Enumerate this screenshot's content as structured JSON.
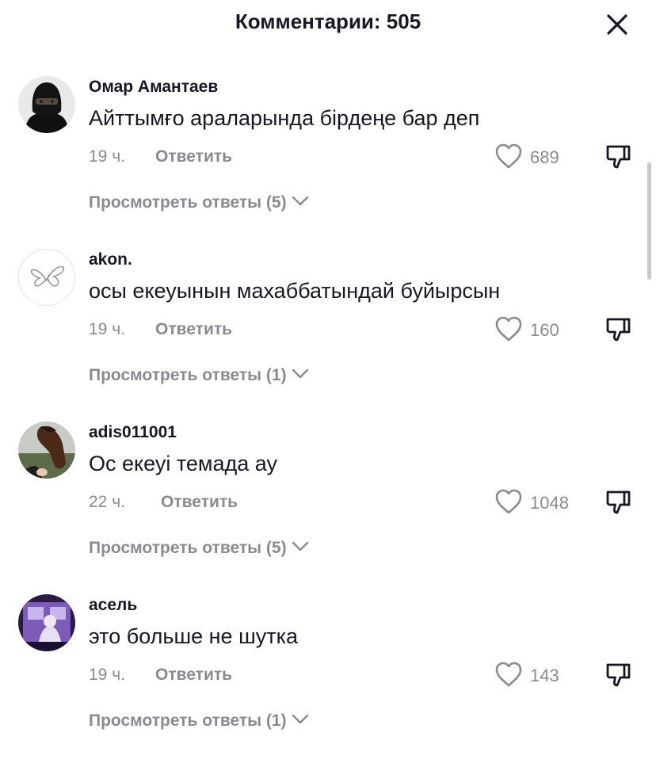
{
  "header": {
    "title": "Комментарии: 505",
    "close_icon": "close-icon"
  },
  "colors": {
    "text": "#161823",
    "secondary": "#8a8b91",
    "background": "#ffffff"
  },
  "comments": [
    {
      "username": "Омар Амантаев",
      "text": "Айттымғо араларында бірдеңе бар деп",
      "time": "19 ч.",
      "reply_label": "Ответить",
      "likes": "689",
      "view_replies": "Просмотреть ответы (5)",
      "avatar": "masked-person-avatar"
    },
    {
      "username": "akon.",
      "text": "осы екеуынын махаббатындай буйырсын",
      "time": "19 ч.",
      "reply_label": "Ответить",
      "likes": "160",
      "view_replies": "Просмотреть ответы (1)",
      "avatar": "butterfly-avatar"
    },
    {
      "username": "adis011001",
      "text": "Ос екеуі темада ау",
      "time": "22 ч.",
      "reply_label": "Ответить",
      "likes": "1048",
      "view_replies": "Просмотреть ответы (5)",
      "avatar": "horse-avatar"
    },
    {
      "username": "асель",
      "text": "это больше не шутка",
      "time": "19 ч.",
      "reply_label": "Ответить",
      "likes": "143",
      "view_replies": "Просмотреть ответы (1)",
      "avatar": "purple-photo-avatar"
    }
  ]
}
